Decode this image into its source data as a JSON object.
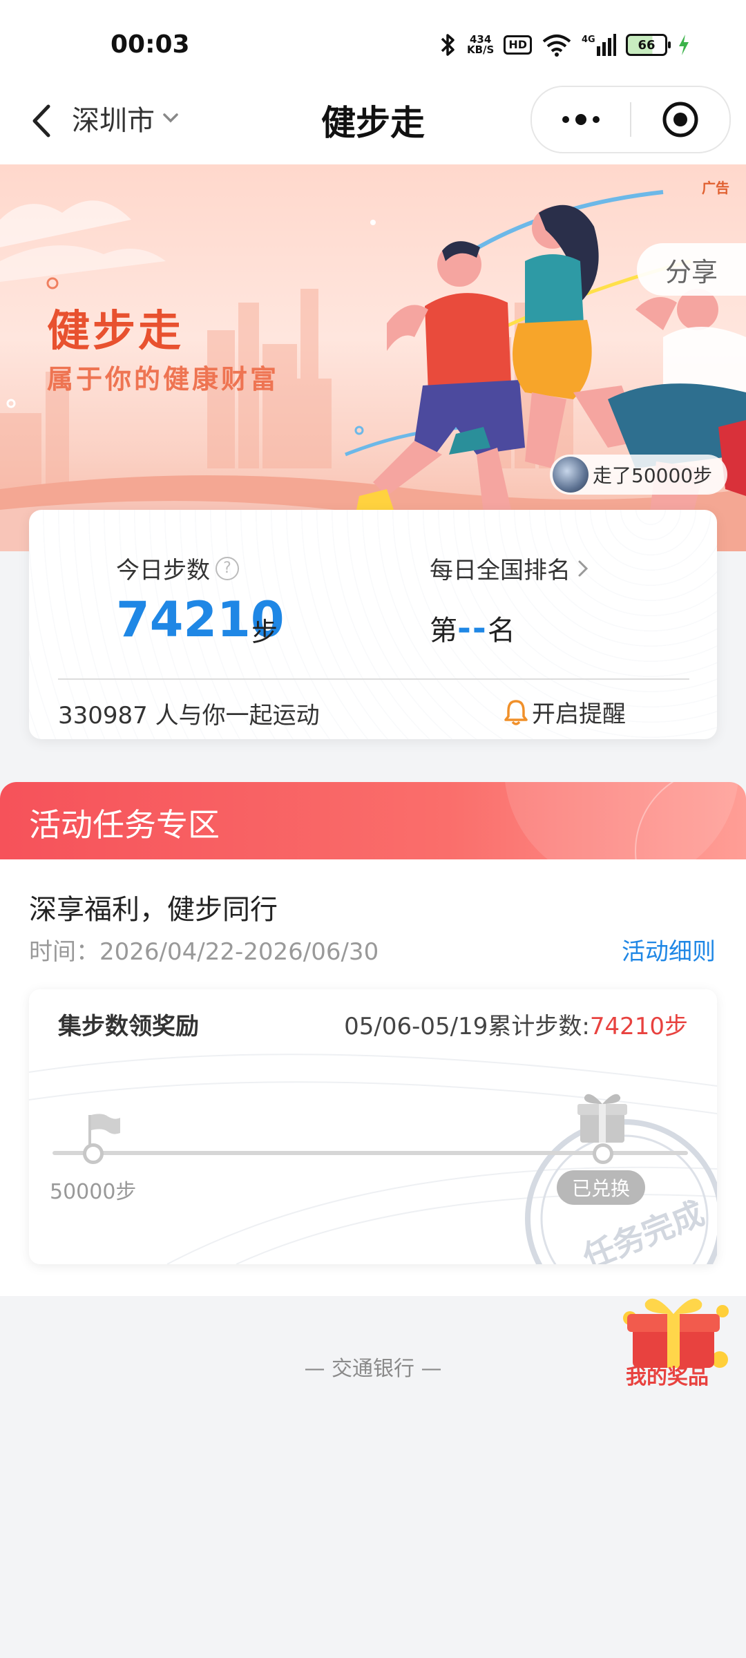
{
  "status_bar": {
    "time": "00:03",
    "net_speed_value": "434",
    "net_speed_unit": "KB/S",
    "hd": "HD",
    "network": "4G",
    "battery": "66"
  },
  "nav": {
    "city": "深圳市",
    "title": "健步走"
  },
  "banner": {
    "ad_tag": "广告",
    "title": "健步走",
    "subtitle": "属于你的健康财富",
    "share": "分享",
    "walk_chip": "走了50000步"
  },
  "steps_card": {
    "today_label": "今日步数",
    "help": "?",
    "today_steps": "74210",
    "steps_unit": "步",
    "rank_label": "每日全国排名",
    "rank_prefix": "第",
    "rank_value": "--",
    "rank_suffix": "名",
    "together": "330987 人与你一起运动",
    "reminder": "开启提醒"
  },
  "activity": {
    "header": "活动任务专区",
    "subtitle": "深享福利，健步同行",
    "time": "时间：2026/04/22-2026/06/30",
    "rules": "活动细则",
    "reward": {
      "title": "集步数领奖励",
      "total_label": "05/06-05/19累计步数:",
      "total_value": "74210步",
      "milestone_label": "50000步",
      "redeemed": "已兑换",
      "stamp_text": "任务完成"
    }
  },
  "footer": {
    "bank": "— 交通银行 —",
    "my_prize": "我的奖品"
  },
  "colors": {
    "accent_blue": "#1f87e5",
    "accent_red": "#e8423f",
    "header_red": "#f6525a"
  }
}
